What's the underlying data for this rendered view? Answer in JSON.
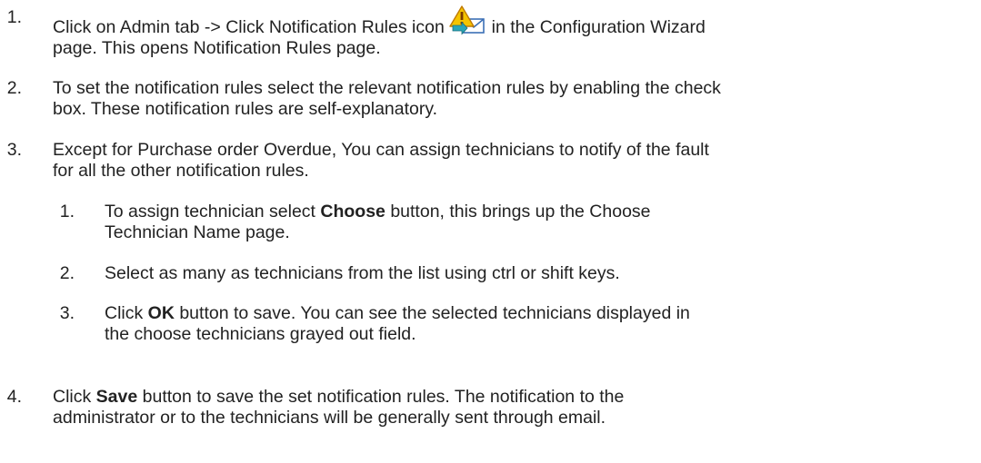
{
  "steps": [
    {
      "num": "1.",
      "line1_pre": "Click on Admin tab -> Click Notification Rules icon ",
      "icon": "notification-rules-icon",
      "line1_post": " in the Configuration Wizard",
      "line2": "page. This opens Notification Rules page."
    },
    {
      "num": "2.",
      "line1": "To set the notification rules select the relevant notification rules by enabling the check",
      "line2": "box. These notification rules are self-explanatory."
    },
    {
      "num": "3.",
      "line1": "Except for Purchase order Overdue, You can assign technicians to notify of the fault",
      "line2": "for all the other notification rules."
    },
    {
      "num": "4.",
      "line1_pre": "Click ",
      "line1_bold": "Save",
      "line1_post": " button to save the set notification rules. The notification to the",
      "line2": "administrator or to the technicians will be generally sent through email."
    }
  ],
  "substeps": [
    {
      "num": "1.",
      "line1_pre": "To assign technician select ",
      "line1_bold": "Choose",
      "line1_post": " button, this brings up the Choose",
      "line2": "Technician Name page."
    },
    {
      "num": "2.",
      "line1": "Select as many as technicians from the list using ctrl or shift keys."
    },
    {
      "num": "3.",
      "line1_pre": "Click ",
      "line1_bold": "OK",
      "line1_post": " button to save. You can see the selected technicians displayed in",
      "line2": "the choose technicians grayed out field."
    }
  ],
  "colors": {
    "text": "#222222",
    "warning_yellow": "#f5c400",
    "warning_outline": "#c07a00",
    "envelope_blue": "#3b6fb6",
    "arrow_teal": "#2aa6b8"
  }
}
